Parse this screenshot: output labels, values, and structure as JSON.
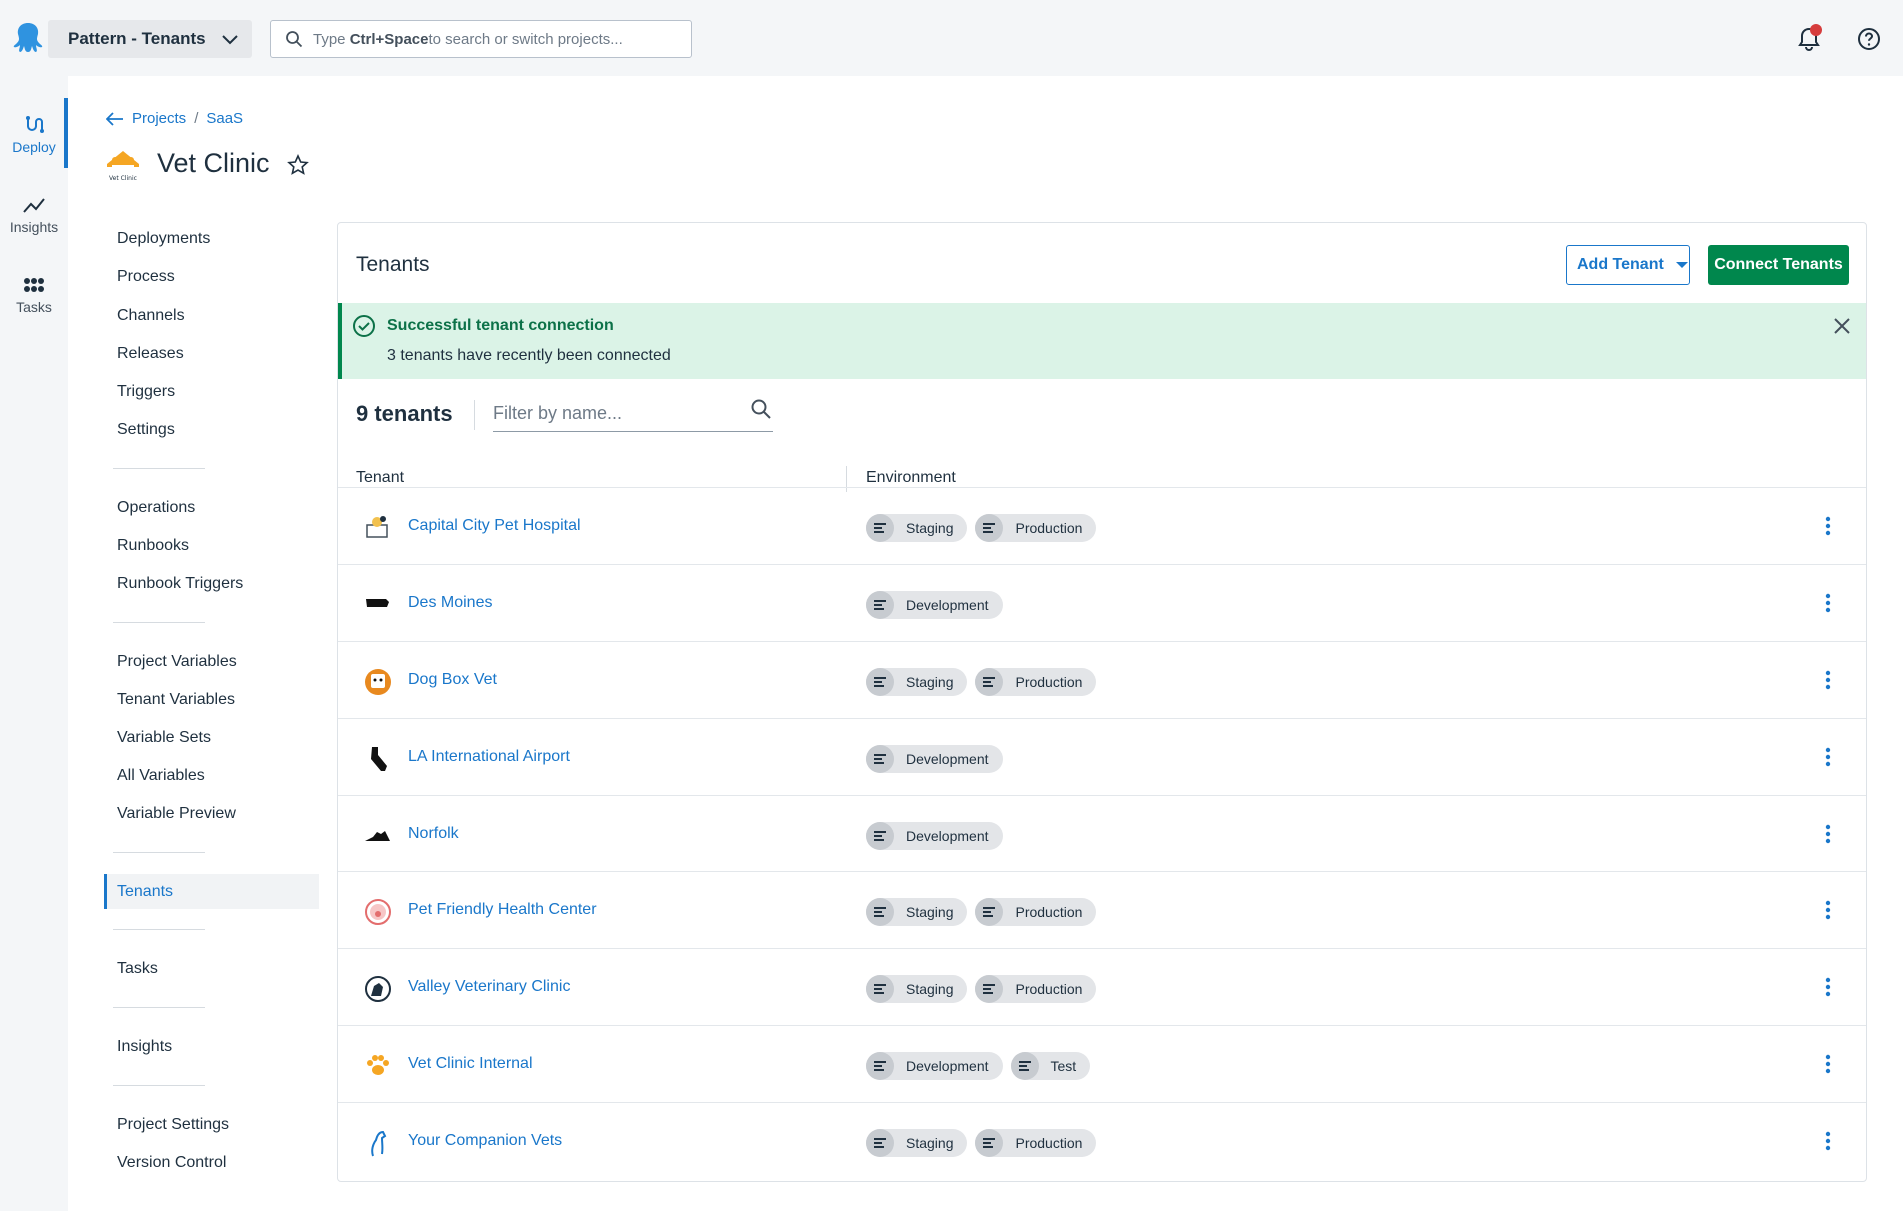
{
  "topbar": {
    "project_switcher": "Pattern - Tenants",
    "search_prefix": "Type ",
    "search_shortcut": "Ctrl+Space",
    "search_suffix": " to search or switch projects..."
  },
  "rail": [
    {
      "label": "Deploy",
      "icon": "deploy-icon",
      "active": true
    },
    {
      "label": "Insights",
      "icon": "insights-icon"
    },
    {
      "label": "Tasks",
      "icon": "tasks-icon"
    }
  ],
  "breadcrumb": {
    "projects": "Projects",
    "separator": "/",
    "group": "SaaS"
  },
  "project": {
    "title": "Vet Clinic",
    "logo_text": "Vet Clinic"
  },
  "project_nav": {
    "deployments": "Deployments",
    "process": "Process",
    "channels": "Channels",
    "releases": "Releases",
    "triggers": "Triggers",
    "settings": "Settings",
    "operations": "Operations",
    "runbooks": "Runbooks",
    "runbook_triggers": "Runbook Triggers",
    "project_variables": "Project Variables",
    "tenant_variables": "Tenant Variables",
    "variable_sets": "Variable Sets",
    "all_variables": "All Variables",
    "variable_preview": "Variable Preview",
    "tenants": "Tenants",
    "tasks": "Tasks",
    "insights": "Insights",
    "project_settings": "Project Settings",
    "version_control": "Version Control"
  },
  "card": {
    "title": "Tenants",
    "add_tenant": "Add Tenant",
    "connect_tenants": "Connect Tenants"
  },
  "alert": {
    "title": "Successful tenant connection",
    "body": "3 tenants have recently been connected"
  },
  "list": {
    "count": "9 tenants",
    "filter_placeholder": "Filter by name...",
    "col_tenant": "Tenant",
    "col_environment": "Environment"
  },
  "tenants": [
    {
      "name": "Capital City Pet Hospital",
      "icon": "pet-hospital-icon",
      "envs": [
        "Staging",
        "Production"
      ]
    },
    {
      "name": "Des Moines",
      "icon": "iowa-map-icon",
      "envs": [
        "Development"
      ]
    },
    {
      "name": "Dog Box Vet",
      "icon": "dog-box-icon",
      "envs": [
        "Staging",
        "Production"
      ]
    },
    {
      "name": "LA International Airport",
      "icon": "california-map-icon",
      "envs": [
        "Development"
      ]
    },
    {
      "name": "Norfolk",
      "icon": "virginia-map-icon",
      "envs": [
        "Development"
      ]
    },
    {
      "name": "Pet Friendly Health Center",
      "icon": "paw-badge-icon",
      "envs": [
        "Staging",
        "Production"
      ]
    },
    {
      "name": "Valley Veterinary Clinic",
      "icon": "dog-cat-icon",
      "envs": [
        "Staging",
        "Production"
      ]
    },
    {
      "name": "Vet Clinic Internal",
      "icon": "paw-print-icon",
      "envs": [
        "Development",
        "Test"
      ]
    },
    {
      "name": "Your Companion Vets",
      "icon": "dog-outline-icon",
      "envs": [
        "Staging",
        "Production"
      ]
    }
  ],
  "colors": {
    "accent": "#1a77ca",
    "success": "#00874d",
    "alert_bg": "#dbf3e7",
    "notification": "#d63d3d"
  }
}
